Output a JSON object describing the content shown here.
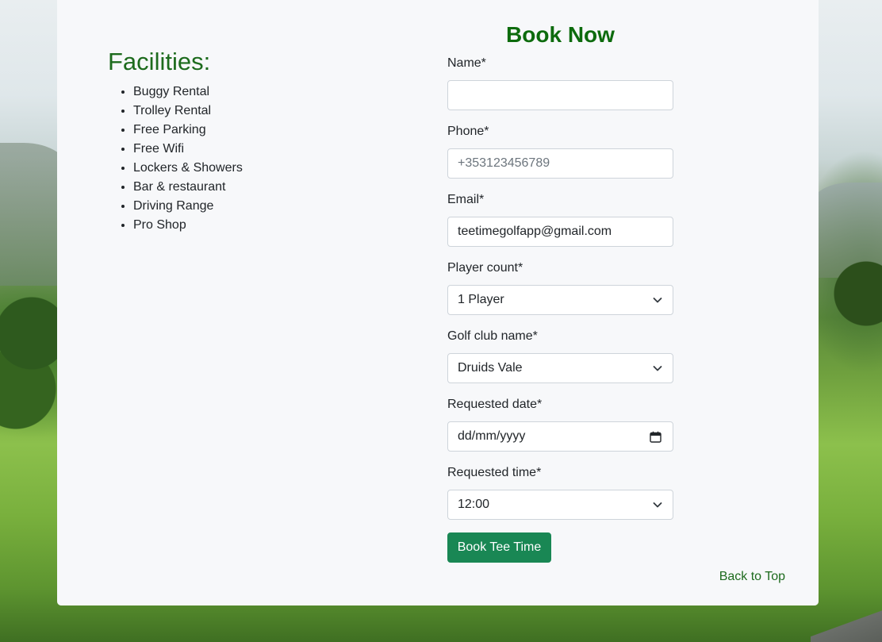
{
  "facilities": {
    "title": "Facilities:",
    "items": [
      "Buggy Rental",
      "Trolley Rental",
      "Free Parking",
      "Free Wifi",
      "Lockers & Showers",
      "Bar & restaurant",
      "Driving Range",
      "Pro Shop"
    ]
  },
  "booking": {
    "title": "Book Now",
    "name": {
      "label": "Name*",
      "value": ""
    },
    "phone": {
      "label": "Phone*",
      "placeholder": "+353123456789"
    },
    "email": {
      "label": "Email*",
      "value": "teetimegolfapp@gmail.com"
    },
    "player_count": {
      "label": "Player count*",
      "selected": "1 Player"
    },
    "golf_club": {
      "label": "Golf club name*",
      "selected": "Druids Vale"
    },
    "date": {
      "label": "Requested date*",
      "placeholder": "dd/mm/yyyy"
    },
    "time": {
      "label": "Requested time*",
      "selected": "12:00"
    },
    "submit_label": "Book Tee Time"
  },
  "footer": {
    "back_to_top": "Back to Top"
  },
  "colors": {
    "heading_green": "#1d6b1d",
    "button_green": "#198754",
    "card_bg": "#f7f8fa"
  }
}
